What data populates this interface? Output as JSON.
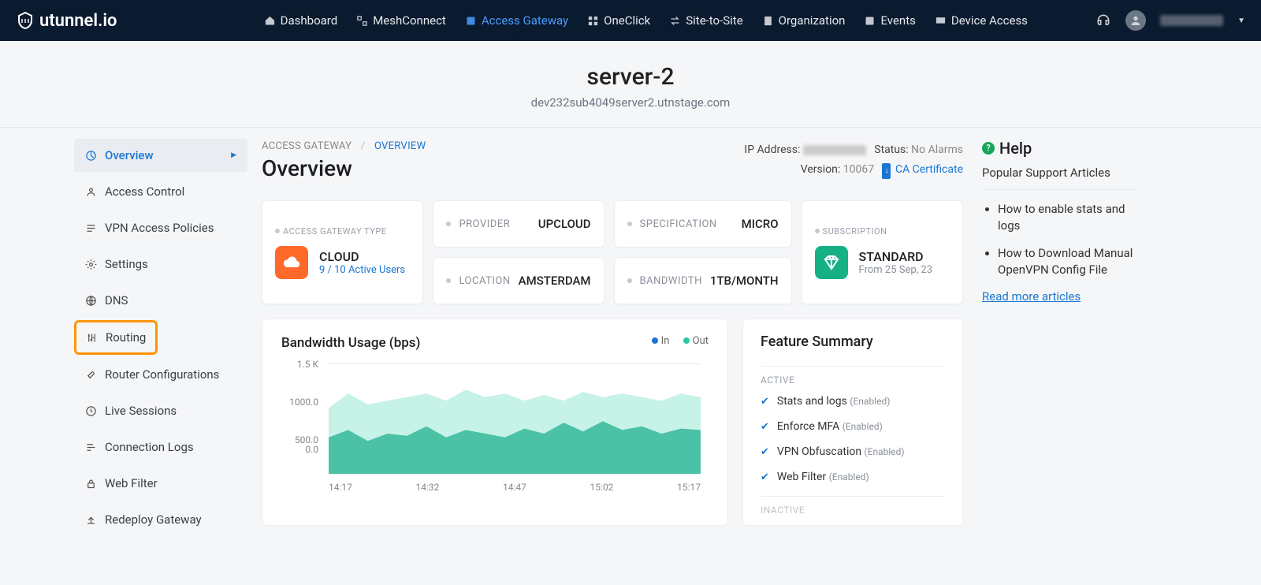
{
  "brand": "utunnel.io",
  "nav": {
    "dashboard": "Dashboard",
    "mesh": "MeshConnect",
    "gateway": "Access Gateway",
    "oneclick": "OneClick",
    "site": "Site-to-Site",
    "org": "Organization",
    "events": "Events",
    "device": "Device Access"
  },
  "server": {
    "name": "server-2",
    "host": "dev232sub4049server2.utnstage.com"
  },
  "sidebar": {
    "overview": "Overview",
    "access": "Access Control",
    "vpn": "VPN Access Policies",
    "settings": "Settings",
    "dns": "DNS",
    "routing": "Routing",
    "router": "Router Configurations",
    "sessions": "Live Sessions",
    "logs": "Connection Logs",
    "filter": "Web Filter",
    "redeploy": "Redeploy Gateway"
  },
  "crumb": {
    "a": "ACCESS GATEWAY",
    "b": "OVERVIEW"
  },
  "status": {
    "ip_label": "IP Address:",
    "status_label": "Status:",
    "status_val": "No Alarms",
    "ver_label": "Version:",
    "ver_val": "10067",
    "ca": "CA Certificate"
  },
  "page_title": "Overview",
  "cards": {
    "type_label": "ACCESS GATEWAY TYPE",
    "type_main": "CLOUD",
    "type_sub": "9 / 10 Active Users",
    "provider_label": "PROVIDER",
    "provider_val": "UPCLOUD",
    "location_label": "LOCATION",
    "location_val": "AMSTERDAM",
    "spec_label": "SPECIFICATION",
    "spec_val": "MICRO",
    "bw_label": "BANDWIDTH",
    "bw_val": "1TB/MONTH",
    "sub_label": "SUBSCRIPTION",
    "sub_main": "STANDARD",
    "sub_sub": "From 25 Sep, 23"
  },
  "chart": {
    "title": "Bandwidth Usage (bps)",
    "legend_in": "In",
    "legend_out": "Out"
  },
  "chart_data": {
    "type": "area",
    "x": [
      "14:17",
      "14:32",
      "14:47",
      "15:02",
      "15:17"
    ],
    "ylim": [
      0,
      1500
    ],
    "y_ticks": [
      "1.5 K",
      "1000.0",
      "500.0",
      "0.0"
    ],
    "series": [
      {
        "name": "In",
        "color": "#c6f2e8",
        "values": [
          900,
          1100,
          950,
          1000,
          1050,
          1100,
          1000,
          1150,
          1050,
          1100,
          1000,
          1080,
          1000,
          1120,
          1050,
          1100,
          1050,
          1000,
          1100,
          1050
        ]
      },
      {
        "name": "Out",
        "color": "#2ec7a6",
        "values": [
          500,
          600,
          450,
          550,
          520,
          650,
          500,
          600,
          550,
          500,
          620,
          550,
          700,
          580,
          720,
          600,
          650,
          550,
          620,
          600
        ]
      }
    ]
  },
  "features": {
    "title": "Feature Summary",
    "active_label": "ACTIVE",
    "inactive_label": "INACTIVE",
    "items": [
      {
        "name": "Stats and logs",
        "state": "(Enabled)"
      },
      {
        "name": "Enforce MFA",
        "state": "(Enabled)"
      },
      {
        "name": "VPN Obfuscation",
        "state": "(Enabled)"
      },
      {
        "name": "Web Filter",
        "state": "(Enabled)"
      }
    ]
  },
  "help": {
    "title": "Help",
    "subtitle": "Popular Support Articles",
    "articles": [
      "How to enable stats and logs",
      "How to Download Manual OpenVPN Config File"
    ],
    "more": "Read more articles"
  }
}
